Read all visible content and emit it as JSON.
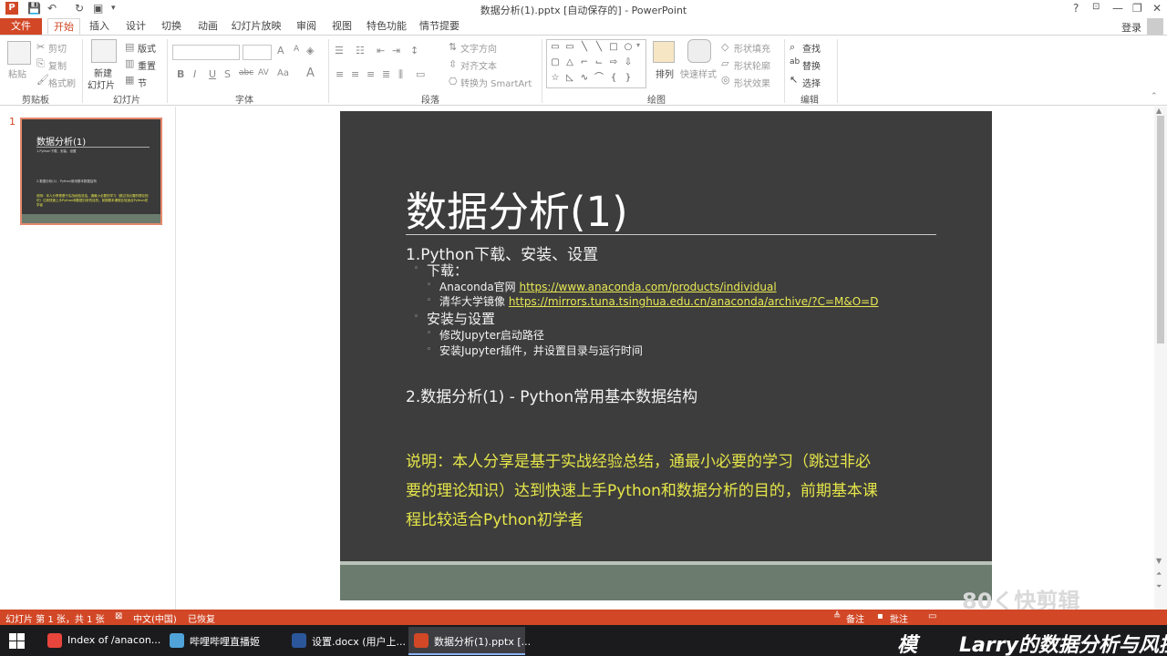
{
  "window": {
    "title": "数据分析(1).pptx [自动保存的] - PowerPoint",
    "app_logo": "P",
    "help": "?",
    "minimize": "—",
    "restore": "❐",
    "close": "✕"
  },
  "tabs": {
    "file": "文件",
    "items": [
      "开始",
      "插入",
      "设计",
      "切换",
      "动画",
      "幻灯片放映",
      "审阅",
      "视图",
      "特色功能",
      "情节提要"
    ],
    "login": "登录"
  },
  "ribbon": {
    "clipboard": {
      "paste": "粘贴",
      "cut": "剪切",
      "copy": "复制",
      "format_painter": "格式刷",
      "label": "剪贴板"
    },
    "slides": {
      "new_slide_1": "新建",
      "new_slide_2": "幻灯片",
      "layout": "版式",
      "reset": "重置",
      "section": "节",
      "label": "幻灯片"
    },
    "font": {
      "bold": "B",
      "italic": "I",
      "underline": "U",
      "shadow": "S",
      "strike": "abc",
      "spacing": "AV",
      "case": "Aa",
      "color": "A",
      "label": "字体"
    },
    "paragraph": {
      "text_direction": "文字方向",
      "align_text": "对齐文本",
      "smartart": "转换为 SmartArt",
      "label": "段落"
    },
    "drawing": {
      "arrange": "排列",
      "quick_styles": "快速样式",
      "shape_fill": "形状填充",
      "shape_outline": "形状轮廓",
      "shape_effects": "形状效果",
      "label": "绘图"
    },
    "editing": {
      "find": "查找",
      "replace": "替换",
      "select": "选择",
      "label": "编辑"
    }
  },
  "thumbnail": {
    "number": "1",
    "title": "数据分析(1)",
    "line1": "1.Python下载、安装、设置",
    "line2": "2.数据分析(1) - Python常用基本数据结构",
    "line3": "说明：本人分享是基于实战经验总结，通最小必要的学习（跳过非必要的理论知识）达到快速上手Python和数据分析的目的，前期基本课程比较适合Python初学者"
  },
  "slide": {
    "title": "数据分析(1)",
    "section1": "1.Python下载、安装、设置",
    "download": "下载：",
    "anaconda_label": "Anaconda官网 ",
    "anaconda_url": "https://www.anaconda.com/products/individual",
    "tsinghua_label": "清华大学镜像 ",
    "tsinghua_url": "https://mirrors.tuna.tsinghua.edu.cn/anaconda/archive/?C=M&O=D",
    "install": "安装与设置",
    "jupyter_path": "修改Jupyter启动路径",
    "jupyter_plugin": "安装Jupyter插件，并设置目录与运行时间",
    "section2": "2.数据分析(1) - Python常用基本数据结构",
    "note_line1": "说明：本人分享是基于实战经验总结，通最小必要的学习（跳过非必",
    "note_line2": "要的理论知识）达到快速上手Python和数据分析的目的，前期基本课",
    "note_line3": "程比较适合Python初学者"
  },
  "statusbar": {
    "slide_info": "幻灯片 第 1 张，共 1 张",
    "language": "中文(中国)",
    "recovered": "已恢复",
    "notes": "备注",
    "comments": "批注"
  },
  "taskbar": {
    "items": [
      {
        "label": "Index of /anacon...",
        "color": "#e8453c"
      },
      {
        "label": "哔哩哔哩直播姬",
        "color": "#4fa3d9"
      },
      {
        "label": "设置.docx (用户上...",
        "color": "#2b579a"
      },
      {
        "label": "数据分析(1).pptx [...",
        "color": "#d24726"
      }
    ],
    "overlay_text": "Larry的数据分析与风控",
    "overlay_char": "模"
  },
  "watermark": "80く快剪辑",
  "colors": {
    "accent": "#d24726",
    "slide_bg": "#3d3d3d",
    "note_yellow": "#e6e64a",
    "footer_green": "#6b7b6e"
  }
}
